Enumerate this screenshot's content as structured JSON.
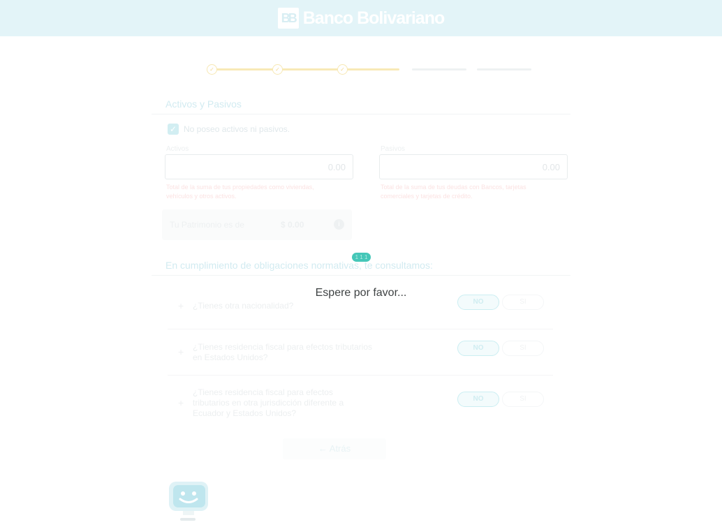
{
  "header": {
    "brand": "Banco Bolivariano",
    "logo_mark": "BB"
  },
  "stepper": {
    "steps_total": 5,
    "steps_completed": 3,
    "check": "✓"
  },
  "assets_section": {
    "title": "Activos y Pasivos",
    "no_assets_checkbox": {
      "label": "No poseo activos ni pasivos.",
      "checked": true,
      "check": "✓"
    },
    "activos": {
      "label": "Activos",
      "value": "0.00",
      "help": "Total de la suma de tus propiedades como viviendas, vehículos y otros activos."
    },
    "pasivos": {
      "label": "Pasivos",
      "value": "0.00",
      "help": "Total de la suma de tus deudas con Bancos, tarjetas comerciales y tarjetas de crédito."
    },
    "patrimonio": {
      "label": "Tu Patrimonio es de",
      "value": "$ 0.00",
      "info_icon": "i"
    }
  },
  "questions_section": {
    "title": "En cumplimiento de obligaciones normativas, te consultamos:",
    "plus": "+",
    "questions": [
      {
        "text": "¿Tienes otra nacionalidad?",
        "no": "NO",
        "si": "SI"
      },
      {
        "text": "¿Tienes residencia fiscal para efectos tributarios en Estados Unidos?",
        "no": "NO",
        "si": "SI"
      },
      {
        "text": "¿Tienes residencia fiscal para efectos tributarios en otra jurisdicción diferente a Ecuador y Estados Unidos?",
        "no": "NO",
        "si": "SI"
      }
    ]
  },
  "back_button": {
    "label": "← Atrás"
  },
  "overlay": {
    "message": "Espere por favor...",
    "loader_text": "1 1 1"
  },
  "colors": {
    "header_bg": "#e3f4f8",
    "accent": "#45c7b8",
    "step_done": "#f8e9b6",
    "step_pending": "#eef1f2"
  },
  "icons": {
    "chatbot": "chatbot-icon",
    "info": "info-icon",
    "check": "check-icon"
  }
}
